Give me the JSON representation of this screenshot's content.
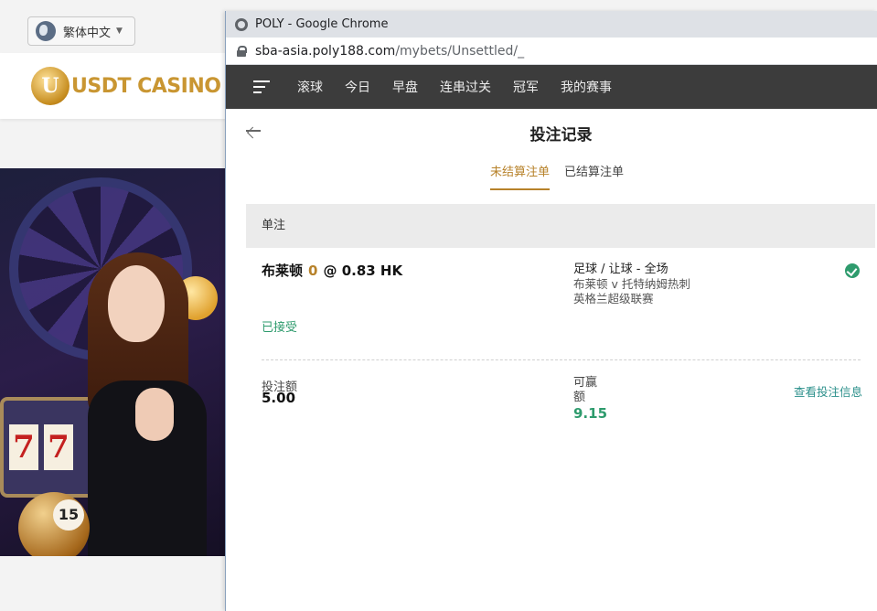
{
  "site": {
    "language_label": "繁体中文",
    "logo_text": "USDT CASINO",
    "logo_mark": "U",
    "banner_ball_number": "15",
    "banner_slot_digits": [
      "7",
      "7"
    ]
  },
  "browser": {
    "window_title": "POLY - Google Chrome",
    "url_host": "sba-asia.poly188.com",
    "url_path": "/mybets/Unsettled/_"
  },
  "nav": {
    "items": [
      "滚球",
      "今日",
      "早盘",
      "连串过关",
      "冠军",
      "我的赛事"
    ]
  },
  "page": {
    "title": "投注记录",
    "tabs": [
      {
        "label": "未结算注单",
        "active": true
      },
      {
        "label": "已结算注单",
        "active": false
      }
    ],
    "section_label": "单注"
  },
  "bet": {
    "selection": "布莱顿",
    "handicap": "0",
    "at": "@",
    "odds": "0.83 HK",
    "market": "足球 / 让球 - 全场",
    "match": "布莱顿 v 托特纳姆热刺",
    "league": "英格兰超级联赛",
    "status": "已接受",
    "stake_label": "投注额",
    "stake_value": "5.00",
    "win_label": "可赢额",
    "win_value": "9.15",
    "view_info_label": "查看投注信息"
  },
  "colors": {
    "accent_gold": "#b7822a",
    "accepted_green": "#2e9b6d",
    "nav_bg": "#3c3c3c"
  }
}
